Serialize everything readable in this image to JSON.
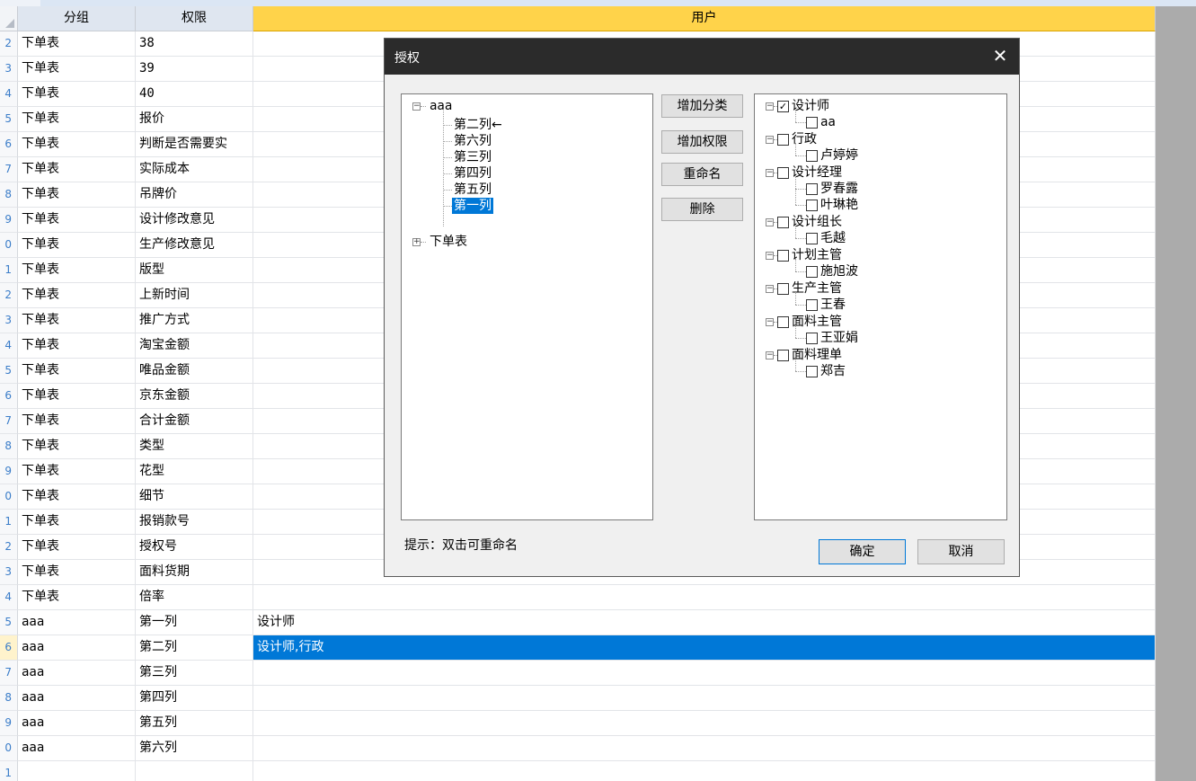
{
  "grid": {
    "headers": {
      "group": "分组",
      "permission": "权限",
      "user": "用户"
    },
    "rows": [
      {
        "num": "2",
        "group": "下单表",
        "perm": "38",
        "user": ""
      },
      {
        "num": "3",
        "group": "下单表",
        "perm": "39",
        "user": ""
      },
      {
        "num": "4",
        "group": "下单表",
        "perm": "40",
        "user": ""
      },
      {
        "num": "5",
        "group": "下单表",
        "perm": "报价",
        "user": ""
      },
      {
        "num": "6",
        "group": "下单表",
        "perm": "判断是否需要实",
        "user": ""
      },
      {
        "num": "7",
        "group": "下单表",
        "perm": "实际成本",
        "user": ""
      },
      {
        "num": "8",
        "group": "下单表",
        "perm": "吊牌价",
        "user": ""
      },
      {
        "num": "9",
        "group": "下单表",
        "perm": "设计修改意见",
        "user": ""
      },
      {
        "num": "0",
        "group": "下单表",
        "perm": "生产修改意见",
        "user": ""
      },
      {
        "num": "1",
        "group": "下单表",
        "perm": "版型",
        "user": ""
      },
      {
        "num": "2",
        "group": "下单表",
        "perm": "上新时间",
        "user": ""
      },
      {
        "num": "3",
        "group": "下单表",
        "perm": "推广方式",
        "user": ""
      },
      {
        "num": "4",
        "group": "下单表",
        "perm": "淘宝金额",
        "user": ""
      },
      {
        "num": "5",
        "group": "下单表",
        "perm": "唯品金额",
        "user": ""
      },
      {
        "num": "6",
        "group": "下单表",
        "perm": "京东金额",
        "user": ""
      },
      {
        "num": "7",
        "group": "下单表",
        "perm": "合计金额",
        "user": ""
      },
      {
        "num": "8",
        "group": "下单表",
        "perm": "类型",
        "user": ""
      },
      {
        "num": "9",
        "group": "下单表",
        "perm": "花型",
        "user": ""
      },
      {
        "num": "0",
        "group": "下单表",
        "perm": "细节",
        "user": ""
      },
      {
        "num": "1",
        "group": "下单表",
        "perm": "报销款号",
        "user": ""
      },
      {
        "num": "2",
        "group": "下单表",
        "perm": "授权号",
        "user": ""
      },
      {
        "num": "3",
        "group": "下单表",
        "perm": "面料货期",
        "user": ""
      },
      {
        "num": "4",
        "group": "下单表",
        "perm": "倍率",
        "user": ""
      },
      {
        "num": "5",
        "group": "aaa",
        "perm": "第一列",
        "user": "设计师"
      },
      {
        "num": "6",
        "group": "aaa",
        "perm": "第二列",
        "user": "设计师,行政"
      },
      {
        "num": "7",
        "group": "aaa",
        "perm": "第三列",
        "user": ""
      },
      {
        "num": "8",
        "group": "aaa",
        "perm": "第四列",
        "user": ""
      },
      {
        "num": "9",
        "group": "aaa",
        "perm": "第五列",
        "user": ""
      },
      {
        "num": "0",
        "group": "aaa",
        "perm": "第六列",
        "user": ""
      },
      {
        "num": "1",
        "group": "",
        "perm": "",
        "user": ""
      }
    ],
    "selected_row_index": 24
  },
  "dialog": {
    "title": "授权",
    "close_icon": "close-icon",
    "left_tree": {
      "root": "aaa",
      "children": [
        "第二列←",
        "第六列",
        "第三列",
        "第四列",
        "第五列",
        "第一列"
      ],
      "selected": "第一列",
      "second_root": "下单表"
    },
    "buttons": {
      "add_category": "增加分类",
      "add_permission": "增加权限",
      "rename": "重命名",
      "delete": "删除"
    },
    "right_tree": [
      {
        "label": "设计师",
        "checked": true,
        "members": [
          {
            "label": "aa",
            "checked": false
          }
        ]
      },
      {
        "label": "行政",
        "checked": false,
        "members": [
          {
            "label": "卢婷婷",
            "checked": false
          }
        ]
      },
      {
        "label": "设计经理",
        "checked": false,
        "members": [
          {
            "label": "罗春露",
            "checked": false
          },
          {
            "label": "叶琳艳",
            "checked": false
          }
        ]
      },
      {
        "label": "设计组长",
        "checked": false,
        "members": [
          {
            "label": "毛越",
            "checked": false
          }
        ]
      },
      {
        "label": "计划主管",
        "checked": false,
        "members": [
          {
            "label": "施旭波",
            "checked": false
          }
        ]
      },
      {
        "label": "生产主管",
        "checked": false,
        "members": [
          {
            "label": "王春",
            "checked": false
          }
        ]
      },
      {
        "label": "面料主管",
        "checked": false,
        "members": [
          {
            "label": "王亚娟",
            "checked": false
          }
        ]
      },
      {
        "label": "面料理单",
        "checked": false,
        "members": [
          {
            "label": "郑吉",
            "checked": false
          }
        ]
      }
    ],
    "hint": "提示：双击可重命名",
    "ok_label": "确定",
    "cancel_label": "取消",
    "colors": {
      "title_bar": "#2b2b2b",
      "selection": "#0078d7"
    }
  }
}
